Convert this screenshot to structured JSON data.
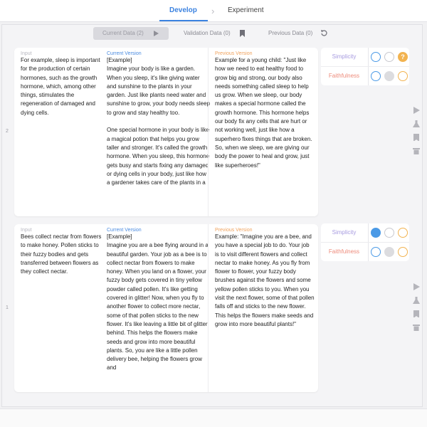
{
  "tabs": {
    "develop": "Develop",
    "experiment": "Experiment"
  },
  "filters": {
    "current": "Current Data (2)",
    "validation": "Validation Data (0)",
    "previous": "Previous Data (0)"
  },
  "rows": [
    {
      "number": "2",
      "input_label": "Input",
      "input_text": "For example, sleep is important for the production of certain hormones, such as the growth hormone, which, among other things, stimulates the regeneration of damaged and dying cells.",
      "current_label": "Current Version",
      "current_text": "[Example]\nImagine your body is like a garden. When you sleep, it's like giving water and sunshine to the plants in your garden. Just like plants need water and sunshine to grow, your body needs sleep to grow and stay healthy too.\n\nOne special hormone in your body is like a magical potion that helps you grow taller and stronger. It's called the growth hormone. When you sleep, this hormone gets busy and starts fixing any damaged or dying cells in your body, just like how a gardener takes care of the plants in a",
      "previous_label": "Previous Version",
      "previous_text": "Example for a young child: \"Just like how we need to eat healthy food to grow big and strong, our body also needs something called sleep to help us grow. When we sleep, our body makes a special hormone called the growth hormone. This hormone helps our body fix any cells that are hurt or not working well, just like how a superhero fixes things that are broken. So, when we sleep, we are giving our body the power to heal and grow, just like superheroes!\"",
      "simplicity_label": "Simplicity",
      "faithfulness_label": "Faithfulness",
      "question_mark": "?"
    },
    {
      "number": "1",
      "input_label": "Input",
      "input_text": "Bees collect nectar from flowers to make honey. Pollen sticks to their fuzzy bodies and gets transferred between flowers as they collect nectar.",
      "current_label": "Current Version",
      "current_text": "[Example]\nImagine you are a bee flying around in a beautiful garden. Your job as a bee is to collect nectar from flowers to make honey. When you land on a flower, your fuzzy body gets covered in tiny yellow powder called pollen. It's like getting covered in glitter! Now, when you fly to another flower to collect more nectar, some of that pollen sticks to the new flower. It's like leaving a little bit of glitter behind. This helps the flowers make seeds and grow into more beautiful plants. So, you are like a little pollen delivery bee, helping the flowers grow and",
      "previous_label": "Previous Version",
      "previous_text": "Example: \"Imagine you are a bee, and you have a special job to do. Your job is to visit different flowers and collect nectar to make honey. As you fly from flower to flower, your fuzzy body brushes against the flowers and some yellow pollen sticks to you. When you visit the next flower, some of that pollen falls off and sticks to the new flower. This helps the flowers make seeds and grow into more beautiful plants!\"",
      "simplicity_label": "Simplicity",
      "faithfulness_label": "Faithfulness"
    }
  ],
  "icons": [
    "play-icon",
    "flask-icon",
    "bookmark-icon",
    "trash-icon",
    "replay-icon",
    "chevron-right-icon"
  ],
  "colors": {
    "accent": "#3b82e0",
    "orange": "#f2b350",
    "purple": "#a79be0",
    "red": "#ee8b7b"
  }
}
